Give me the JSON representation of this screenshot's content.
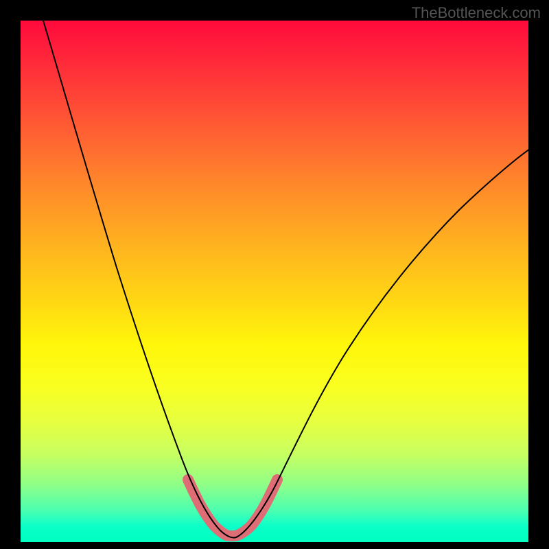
{
  "watermark": "TheBottleneck.com",
  "chart_data": {
    "type": "line",
    "title": "",
    "xlabel": "",
    "ylabel": "",
    "xlim": [
      0,
      100
    ],
    "ylim": [
      0,
      100
    ],
    "grid": false,
    "legend": false,
    "series": [
      {
        "name": "bottleneck-curve",
        "color": "#000000",
        "x": [
          0,
          5,
          10,
          15,
          20,
          25,
          28,
          30,
          32,
          34,
          36,
          38,
          40,
          42,
          44,
          46,
          48,
          50,
          55,
          60,
          65,
          70,
          75,
          80,
          85,
          90,
          95,
          100
        ],
        "y": [
          100,
          88,
          76,
          64,
          52,
          38,
          28,
          22,
          16,
          10,
          6,
          3,
          1,
          0.5,
          1,
          3,
          6,
          10,
          20,
          30,
          38,
          46,
          53,
          59,
          64,
          68,
          72,
          75
        ]
      },
      {
        "name": "optimal-highlight",
        "color": "#de6d75",
        "x": [
          33,
          35,
          37,
          39,
          41,
          43,
          45,
          47,
          49
        ],
        "y": [
          12,
          7,
          4,
          2,
          1,
          2,
          4,
          7,
          12
        ]
      }
    ],
    "gradient_stops": [
      {
        "pos": 0,
        "color": "#ff0a3c"
      },
      {
        "pos": 100,
        "color": "#00ffc0"
      }
    ]
  }
}
